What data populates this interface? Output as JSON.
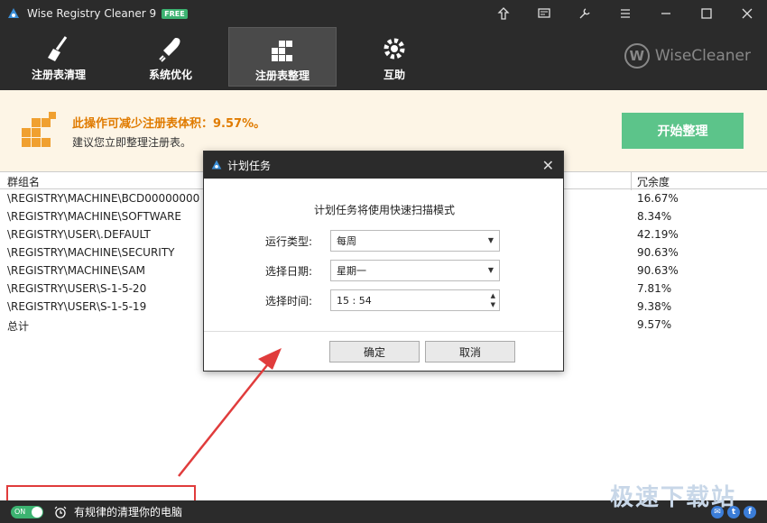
{
  "app": {
    "title": "Wise Registry Cleaner 9",
    "badge": "FREE"
  },
  "nav": {
    "items": [
      {
        "label": "注册表清理"
      },
      {
        "label": "系统优化"
      },
      {
        "label": "注册表整理"
      },
      {
        "label": "互助"
      }
    ],
    "active_index": 2
  },
  "brand": {
    "logo_letter": "W",
    "name": "WiseCleaner"
  },
  "banner": {
    "title": "此操作可减少注册表体积：9.57%。",
    "subtitle": "建议您立即整理注册表。",
    "action_label": "开始整理"
  },
  "table": {
    "headers": {
      "group": "群组名",
      "redundancy": "冗余度"
    },
    "rows": [
      {
        "key": "\\REGISTRY\\MACHINE\\BCD00000000",
        "pct": "16.67%"
      },
      {
        "key": "\\REGISTRY\\MACHINE\\SOFTWARE",
        "pct": "8.34%"
      },
      {
        "key": "\\REGISTRY\\USER\\.DEFAULT",
        "pct": "42.19%"
      },
      {
        "key": "\\REGISTRY\\MACHINE\\SECURITY",
        "pct": "90.63%"
      },
      {
        "key": "\\REGISTRY\\MACHINE\\SAM",
        "pct": "90.63%"
      },
      {
        "key": "\\REGISTRY\\USER\\S-1-5-20",
        "pct": "7.81%"
      },
      {
        "key": "\\REGISTRY\\USER\\S-1-5-19",
        "pct": "9.38%"
      },
      {
        "key": "总计",
        "pct": "9.57%"
      }
    ]
  },
  "dialog": {
    "title": "计划任务",
    "message": "计划任务将使用快速扫描模式",
    "run_type_label": "运行类型:",
    "run_type_value": "每周",
    "date_label": "选择日期:",
    "date_value": "星期一",
    "time_label": "选择时间:",
    "time_value": "15 : 54",
    "ok_label": "确定",
    "cancel_label": "取消"
  },
  "bottom": {
    "toggle_label": "ON",
    "schedule_text": "有规律的清理你的电脑"
  },
  "watermark": "极速下载站",
  "colors": {
    "accent_green": "#5cc48a",
    "dark_bg": "#2b2b2b",
    "banner_orange": "#e07b00",
    "annotation_red": "#e03c3c"
  }
}
